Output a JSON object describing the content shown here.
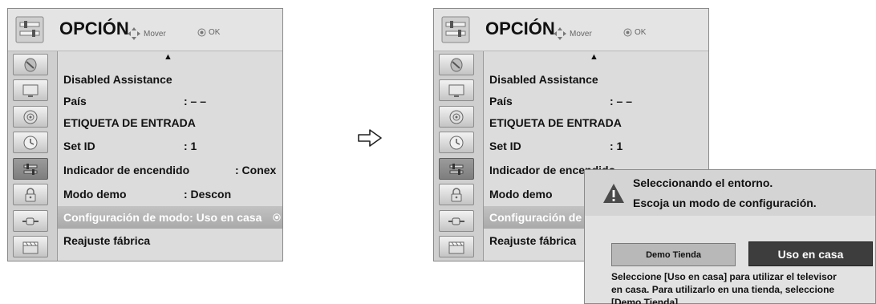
{
  "menus": [
    {
      "id": "left",
      "title": "OPCIÓN",
      "hint_move": "Mover",
      "hint_ok": "OK",
      "scroll_indicator": "▲",
      "sidebar_icons": [
        "satellite-icon",
        "tv-screen-icon",
        "speaker-icon",
        "clock-icon",
        "option-icon",
        "lock-icon",
        "plug-icon",
        "clapperboard-icon"
      ],
      "active_icon": "option-icon",
      "items": [
        {
          "label": "Disabled Assistance",
          "value": ""
        },
        {
          "label": "País",
          "value": ": – –"
        },
        {
          "label": "ETIQUETA DE ENTRADA",
          "value": ""
        },
        {
          "label": "Set ID",
          "value": ": 1"
        },
        {
          "label": "Indicador de encendido",
          "value": ": Conex"
        },
        {
          "label": "Modo demo",
          "value": ": Descon"
        },
        {
          "label": "Configuración de modo: Uso en casa",
          "value": "",
          "selected": true
        },
        {
          "label": "Reajuste fábrica",
          "value": ""
        }
      ]
    },
    {
      "id": "right",
      "title": "OPCIÓN",
      "hint_move": "Mover",
      "hint_ok": "OK",
      "scroll_indicator": "▲",
      "items": [
        {
          "label": "Disabled Assistance",
          "value": ""
        },
        {
          "label": "País",
          "value": ": – –"
        },
        {
          "label": "ETIQUETA DE ENTRADA",
          "value": ""
        },
        {
          "label": "Set ID",
          "value": ": 1"
        },
        {
          "label": "Indicador de encendido",
          "value": ""
        },
        {
          "label": "Modo demo",
          "value": ""
        },
        {
          "label": "Configuración de",
          "value": "",
          "selected": true
        },
        {
          "label": "Reajuste fábrica",
          "value": ""
        }
      ]
    }
  ],
  "transition_arrow": "arrow-right-icon",
  "popup": {
    "line1": "Seleccionando el entorno.",
    "line2": "Escoja un modo de configuración.",
    "demo_button": "Demo Tienda",
    "home_button": "Uso en casa",
    "description_lines": [
      "Seleccione [Uso en casa] para utilizar el televisor",
      "en casa. Para utilizarlo en una tienda, seleccione",
      "[Demo Tienda]."
    ]
  },
  "colors": {
    "menu_bg": "#dcdcdc",
    "selected_row": "#a9a9a9",
    "home_button_bg": "#3d3d3d",
    "demo_button_bg": "#b8b8b8"
  }
}
